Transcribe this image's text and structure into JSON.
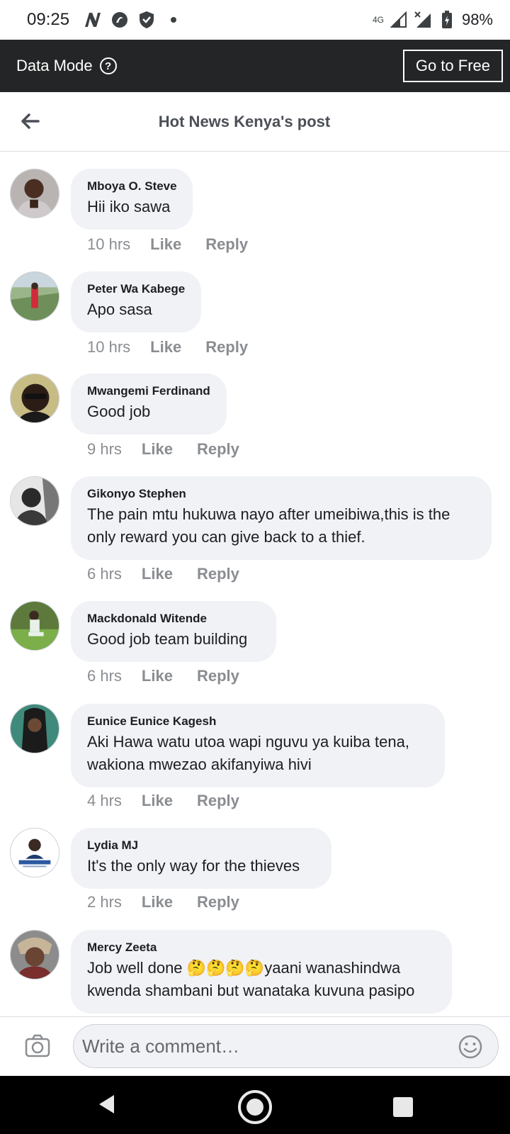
{
  "status_bar": {
    "time": "09:25",
    "network": "4G",
    "battery": "98%"
  },
  "data_bar": {
    "label": "Data Mode",
    "help_glyph": "?",
    "go_free": "Go to Free"
  },
  "header": {
    "title": "Hot News Kenya's post"
  },
  "comments": [
    {
      "name": "Mboya O. Steve",
      "text": "Hii iko sawa",
      "time": "10 hrs",
      "like": "Like",
      "reply": "Reply"
    },
    {
      "name": "Peter Wa Kabege",
      "text": "Apo sasa",
      "time": "10 hrs",
      "like": "Like",
      "reply": "Reply"
    },
    {
      "name": "Mwangemi Ferdinand",
      "text": "Good job",
      "time": "9 hrs",
      "like": "Like",
      "reply": "Reply"
    },
    {
      "name": "Gikonyo Stephen",
      "text": "The pain mtu hukuwa nayo after umeibiwa,this is the only reward you can give back to a thief.",
      "time": "6 hrs",
      "like": "Like",
      "reply": "Reply"
    },
    {
      "name": "Mackdonald Witende",
      "text": "Good job team building",
      "time": "6 hrs",
      "like": "Like",
      "reply": "Reply"
    },
    {
      "name": "Eunice Eunice Kagesh",
      "text": "Aki Hawa watu utoa wapi nguvu ya kuiba tena, wakiona mwezao akifanyiwa hivi",
      "time": "4 hrs",
      "like": "Like",
      "reply": "Reply"
    },
    {
      "name": "Lydia MJ",
      "text": "It's the only way for the thieves",
      "time": "2 hrs",
      "like": "Like",
      "reply": "Reply"
    },
    {
      "name": "Mercy Zeeta",
      "text": "Job well done 🤔🤔🤔🤔yaani wanashindwa kwenda shambani but wanataka kuvuna pasipo",
      "time": "",
      "like": "",
      "reply": ""
    }
  ],
  "composer": {
    "placeholder": "Write a comment…"
  },
  "icons": {
    "back": "arrow-left-icon",
    "camera": "camera-icon",
    "emoji": "smiley-icon"
  },
  "colors": {
    "data_bar_bg": "#242526",
    "bubble_bg": "#f0f2f5",
    "meta_text": "#8a8d91"
  }
}
